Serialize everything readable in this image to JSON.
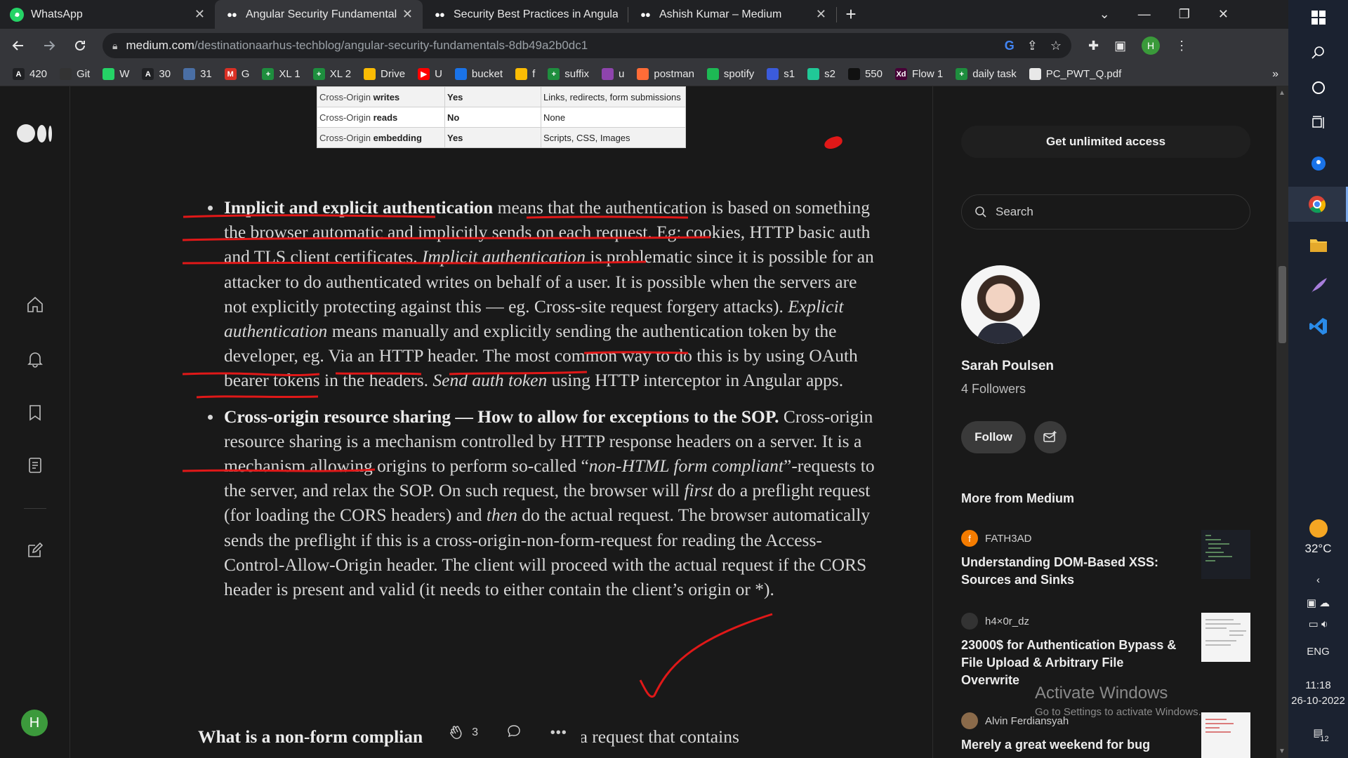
{
  "browser": {
    "tabs": [
      {
        "title": "WhatsApp",
        "favicon": "whatsapp-icon",
        "active": false
      },
      {
        "title": "Angular Security Fundamentals. T",
        "favicon": "medium-icon",
        "active": true
      },
      {
        "title": "Security Best Practices in Angular",
        "favicon": "medium-icon",
        "active": false
      },
      {
        "title": "Ashish Kumar – Medium",
        "favicon": "medium-icon",
        "active": false
      }
    ],
    "url_host": "medium.com",
    "url_path": "/destinationaarhus-techblog/angular-security-fundamentals-8db49a2b0dc1",
    "profile_initial": "H",
    "bookmarks": [
      {
        "label": "420",
        "icon": "A",
        "color": "#202124"
      },
      {
        "label": "Git",
        "icon": "",
        "color": "#333333"
      },
      {
        "label": "W",
        "icon": "",
        "color": "#25d366"
      },
      {
        "label": "30",
        "icon": "A",
        "color": "#202124"
      },
      {
        "label": "31",
        "icon": "",
        "color": "#4a6fa5"
      },
      {
        "label": "G",
        "icon": "M",
        "color": "#d93025"
      },
      {
        "label": "XL 1",
        "icon": "+",
        "color": "#1e8e3e"
      },
      {
        "label": "XL 2",
        "icon": "+",
        "color": "#1e8e3e"
      },
      {
        "label": "Drive",
        "icon": "",
        "color": "#fbbc04"
      },
      {
        "label": "U",
        "icon": "▶",
        "color": "#ff0000"
      },
      {
        "label": "bucket",
        "icon": "",
        "color": "#1a73e8"
      },
      {
        "label": "f",
        "icon": "",
        "color": "#fbbc04"
      },
      {
        "label": "suffix",
        "icon": "+",
        "color": "#1e8e3e"
      },
      {
        "label": "u",
        "icon": "",
        "color": "#8e44ad"
      },
      {
        "label": "postman",
        "icon": "",
        "color": "#ff6c37"
      },
      {
        "label": "spotify",
        "icon": "",
        "color": "#1db954"
      },
      {
        "label": "s1",
        "icon": "",
        "color": "#3b5bdb"
      },
      {
        "label": "s2",
        "icon": "",
        "color": "#20c997"
      },
      {
        "label": "550",
        "icon": "",
        "color": "#111111"
      },
      {
        "label": "Flow 1",
        "icon": "Xd",
        "color": "#470137"
      },
      {
        "label": "daily task",
        "icon": "+",
        "color": "#1e8e3e"
      },
      {
        "label": "PC_PWT_Q.pdf",
        "icon": "",
        "color": "#e8e8e8"
      }
    ]
  },
  "sop_table": [
    {
      "c1_plain": "Cross-Origin ",
      "c1_bold": "writes",
      "c2": "Yes",
      "c3": "Links, redirects, form submissions"
    },
    {
      "c1_plain": "Cross-Origin ",
      "c1_bold": "reads",
      "c2": "No",
      "c3": "None"
    },
    {
      "c1_plain": "Cross-Origin ",
      "c1_bold": "embedding",
      "c2": "Yes",
      "c3": "Scripts, CSS, Images"
    }
  ],
  "article": {
    "b1_bold": "Implicit and explicit authentication",
    "b1_t1": " means that the authentication is based on something the browser automatic and implicitly sends on each request. Eg: cookies, HTTP basic auth and TLS client certificates. ",
    "b1_i1": "Implicit authentication",
    "b1_t2": " is problematic since it is possible for an attacker to do authenticated writes on behalf of a user. It is possible when the servers are not explicitly protecting against this — eg. Cross-site request forgery attacks). ",
    "b1_i2": "Explicit authentication",
    "b1_t3": " means manually and explicitly sending the authentication token by the developer, eg. Via an HTTP header. The most common way to do this is by using OAuth bearer tokens in the headers. ",
    "b1_i3": "Send auth token",
    "b1_t4": " using HTTP interceptor in Angular apps.",
    "b2_bold": "Cross-origin resource sharing — How to allow for exceptions to the SOP.",
    "b2_t1": " Cross-origin resource sharing is a mechanism controlled by HTTP response headers on a server. It is a mechanism allowing origins to perform so-called “",
    "b2_i1": "non-HTML form compliant",
    "b2_t2": "”-requests to the server, and relax the SOP. On such request, the browser will ",
    "b2_i2": "first",
    "b2_t3": " do a preflight request (for loading the CORS headers) and ",
    "b2_i3": "then",
    "b2_t4": " do the actual request. The browser automatically sends the preflight if this is a cross-origin-non-form-request for reading the Access-Control-Allow-Origin header. The client will proceed with the actual request if the CORS header is present and valid (it needs to either contain the client’s origin or *).",
    "next_bold": "What is a non-form complian",
    "next_text": "is a request that contains",
    "claps": "3"
  },
  "sidebar": {
    "get_access": "Get unlimited access",
    "search_placeholder": "Search",
    "author_name": "Sarah Poulsen",
    "followers": "4 Followers",
    "follow": "Follow",
    "more_from": "More from Medium",
    "stories": [
      {
        "author": "FATH3AD",
        "title": "Understanding DOM-Based XSS: Sources and Sinks",
        "avatar_color": "#f57c00",
        "avatar_letter": "f"
      },
      {
        "author": "h4×0r_dz",
        "title": "23000$ for Authentication Bypass & File Upload & Arbitrary File Overwrite",
        "avatar_color": "#222222",
        "avatar_letter": ""
      },
      {
        "author": "Alvin Ferdiansyah",
        "title": "Merely a great weekend for bug",
        "avatar_color": "#8a6a4a",
        "avatar_letter": ""
      }
    ]
  },
  "overlay": {
    "activate_title": "Activate Windows",
    "activate_sub": "Go to Settings to activate Windows."
  },
  "taskbar": {
    "temperature": "32°C",
    "language": "ENG",
    "time": "11:18",
    "date": "26-10-2022",
    "notifications": "12"
  }
}
